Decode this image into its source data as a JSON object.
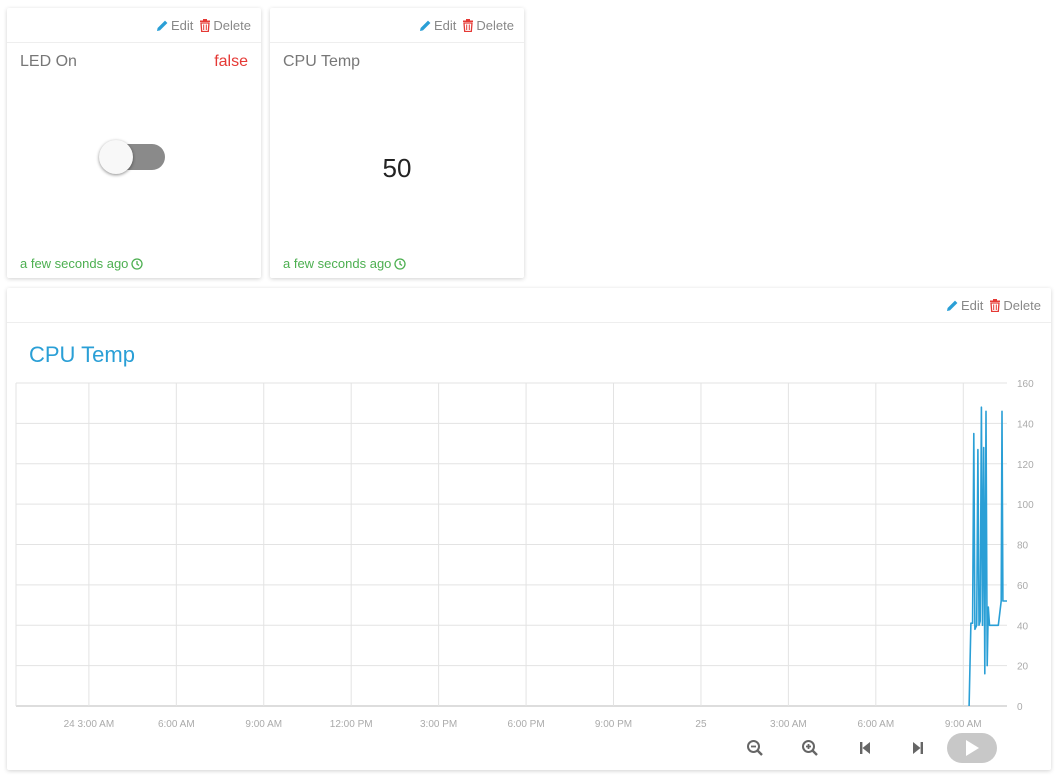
{
  "actions": {
    "edit_label": "Edit",
    "delete_label": "Delete"
  },
  "widget_led": {
    "title": "LED On",
    "value": "false",
    "toggle_on": false,
    "timestamp": "a few seconds ago"
  },
  "widget_cpu": {
    "title": "CPU Temp",
    "value": "50",
    "timestamp": "a few seconds ago"
  },
  "chart_panel": {
    "title": "CPU Temp",
    "controls": [
      "zoom-out",
      "zoom-in",
      "skip-back",
      "skip-forward",
      "play"
    ]
  },
  "colors": {
    "accent": "#2a9fd6",
    "danger": "#e53935",
    "success": "#4caf50",
    "toggle_off": "#8a8a8a"
  },
  "chart_data": {
    "type": "line",
    "title": "CPU Temp",
    "xlabel": "",
    "ylabel": "",
    "ylim": [
      0,
      160
    ],
    "yticks": [
      0,
      20,
      40,
      60,
      80,
      100,
      120,
      140,
      160
    ],
    "xlim": [
      0.5,
      34.5
    ],
    "xtick_labels": [
      {
        "x": 3,
        "label": "24 3:00 AM"
      },
      {
        "x": 6,
        "label": "6:00 AM"
      },
      {
        "x": 9,
        "label": "9:00 AM"
      },
      {
        "x": 12,
        "label": "12:00 PM"
      },
      {
        "x": 15,
        "label": "3:00 PM"
      },
      {
        "x": 18,
        "label": "6:00 PM"
      },
      {
        "x": 21,
        "label": "9:00 PM"
      },
      {
        "x": 24,
        "label": "25"
      },
      {
        "x": 27,
        "label": "3:00 AM"
      },
      {
        "x": 30,
        "label": "6:00 AM"
      },
      {
        "x": 33,
        "label": "9:00 AM"
      }
    ],
    "grid": true,
    "series": [
      {
        "color": "#2a9fd6",
        "points": [
          [
            33.2,
            0
          ],
          [
            33.26,
            41
          ],
          [
            33.32,
            41
          ],
          [
            33.36,
            135
          ],
          [
            33.4,
            38
          ],
          [
            33.46,
            40
          ],
          [
            33.5,
            127
          ],
          [
            33.54,
            40
          ],
          [
            33.58,
            42
          ],
          [
            33.62,
            148
          ],
          [
            33.66,
            40
          ],
          [
            33.7,
            128
          ],
          [
            33.74,
            16
          ],
          [
            33.78,
            146
          ],
          [
            33.82,
            20
          ],
          [
            33.86,
            49
          ],
          [
            33.9,
            40
          ],
          [
            33.95,
            40
          ],
          [
            34.1,
            40
          ],
          [
            34.2,
            40
          ],
          [
            34.26,
            47
          ],
          [
            34.3,
            52
          ],
          [
            34.33,
            146
          ],
          [
            34.36,
            52
          ],
          [
            34.5,
            52
          ]
        ]
      }
    ]
  }
}
